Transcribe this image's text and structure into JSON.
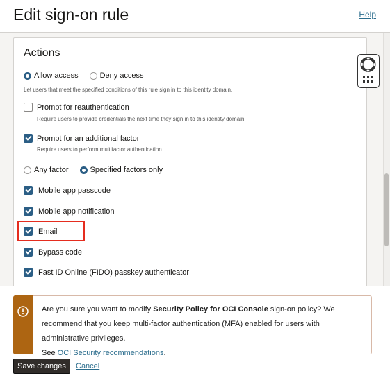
{
  "header": {
    "title": "Edit sign-on rule",
    "help": "Help"
  },
  "actions": {
    "title": "Actions",
    "access": {
      "options": [
        "Allow access",
        "Deny access"
      ],
      "selected": "Allow access",
      "description": "Let users that meet the specified conditions of this rule sign in to this identity domain."
    },
    "reauth": {
      "label": "Prompt for reauthentication",
      "checked": false,
      "description": "Require users to provide credentials the next time they sign in to this identity domain."
    },
    "additional_factor": {
      "label": "Prompt for an additional factor",
      "checked": true,
      "description": "Require users to perform multifactor authentication."
    },
    "factor_mode": {
      "options": [
        "Any factor",
        "Specified factors only"
      ],
      "selected": "Specified factors only"
    },
    "factors": [
      {
        "label": "Mobile app passcode",
        "checked": true
      },
      {
        "label": "Mobile app notification",
        "checked": true
      },
      {
        "label": "Email",
        "checked": true,
        "highlighted": true
      },
      {
        "label": "Bypass code",
        "checked": true
      },
      {
        "label": "Fast ID Online (FIDO) passkey authenticator",
        "checked": true
      }
    ]
  },
  "warning": {
    "prefix": "Are you sure you want to modify ",
    "policy": "Security Policy for OCI Console",
    "middle": " sign-on policy? We recommend that you keep multi-factor authentication (MFA) enabled for users with administrative privileges.",
    "see": "See ",
    "link": "OCI Security recommendations",
    "suffix": ".",
    "color": "#ad6512"
  },
  "footer": {
    "save": "Save changes",
    "cancel": "Cancel"
  },
  "colors": {
    "accent": "#2b5e85",
    "highlight": "#e52d1f"
  }
}
